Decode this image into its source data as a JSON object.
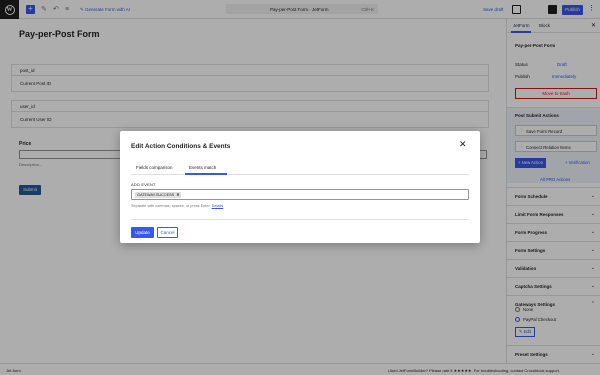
{
  "topbar": {
    "generate_label": "Generate Form with AI",
    "doc_title": "Pay-per-Post Form · JetForm",
    "shortcut": "Ctrl+K",
    "save_draft": "Save draft",
    "publish": "Publish"
  },
  "editor": {
    "page_title": "Pay-per-Post Form",
    "field1_label": "post_id",
    "field1_value": "Current Post ID",
    "field2_label": "user_id",
    "field2_value": "Current User ID",
    "price_label": "Price",
    "desc_text": "Description...",
    "submit_label": "Submit"
  },
  "sidebar": {
    "tab1": "JetForm",
    "tab2": "Block",
    "form_name": "Pay-per-Post Form",
    "status_label": "Status",
    "status_value": "Draft",
    "publish_label": "Publish",
    "publish_value": "Immediately",
    "trash": "Move to trash",
    "psa_title": "Post Submit Actions",
    "action1": "Save Form Record",
    "action2": "Connect Relation Items",
    "new_action": "+ New Action",
    "verification": "+ Verification",
    "all_pro": "All PRO Actions",
    "sections": [
      "Form Schedule",
      "Limit Form Responses",
      "Form Progress",
      "Form Settings",
      "Validation",
      "Captcha Settings",
      "Gateways Settings"
    ],
    "radio_none": "None",
    "radio_paypal": "PayPal Checkout",
    "edit": "Edit",
    "preset": "Preset Settings"
  },
  "footer": {
    "left": "Jet-form",
    "right": "Liked JetFormBuilder? Please rate it ★★★★★. For troubleshooting, contact Crocoblock support."
  },
  "modal": {
    "title": "Edit Action Conditions & Events",
    "tab_fields": "Fields comparison",
    "tab_events": "Events match",
    "add_event_label": "ADD EVENT",
    "chip": "GATEWAY.SUCCESS",
    "help_text": "Separate with commas, spaces, or press Enter.",
    "help_link": "Details",
    "update": "Update",
    "cancel": "Cancel"
  }
}
